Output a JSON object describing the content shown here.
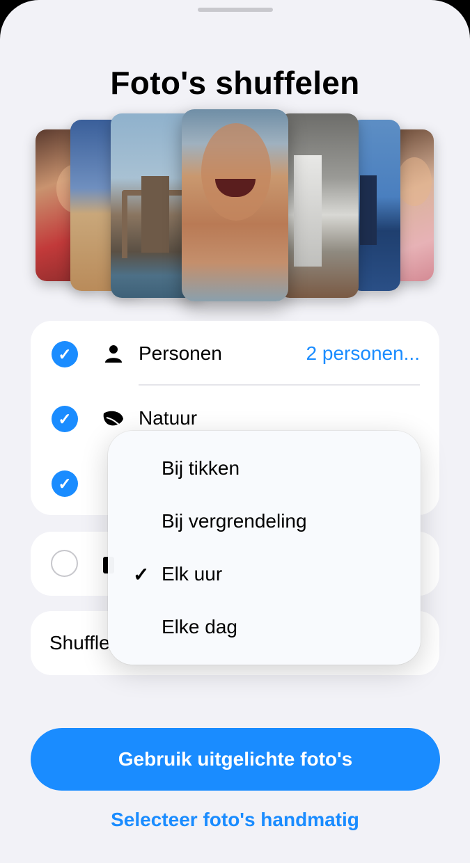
{
  "sheet": {
    "title": "Foto's shuffelen"
  },
  "photos": [
    {
      "subject": "girl-portrait"
    },
    {
      "subject": "beach"
    },
    {
      "subject": "brooklyn-bridge"
    },
    {
      "subject": "laughing-boy"
    },
    {
      "subject": "waterfall"
    },
    {
      "subject": "lighthouse"
    },
    {
      "subject": "smiling-girl"
    }
  ],
  "categories": {
    "items": [
      {
        "label": "Personen",
        "value": "2 personen...",
        "checked": true,
        "icon": "person-icon"
      },
      {
        "label": "Natuur",
        "value": "",
        "checked": true,
        "icon": "leaf-icon"
      },
      {
        "label": "",
        "value": "",
        "checked": true,
        "icon": ""
      }
    ]
  },
  "other_option": {
    "checked": false,
    "icon": "bag-icon"
  },
  "shuffle_row": {
    "label": "Shuffle"
  },
  "frequency_menu": {
    "options": [
      {
        "label": "Bij tikken",
        "selected": false
      },
      {
        "label": "Bij vergrendeling",
        "selected": false
      },
      {
        "label": "Elk uur",
        "selected": true
      },
      {
        "label": "Elke dag",
        "selected": false
      }
    ],
    "check_glyph": "✓"
  },
  "actions": {
    "primary": "Gebruik uitgelichte foto's",
    "secondary": "Selecteer foto's handmatig"
  },
  "colors": {
    "accent": "#1a8cff",
    "background": "#f2f2f7"
  }
}
